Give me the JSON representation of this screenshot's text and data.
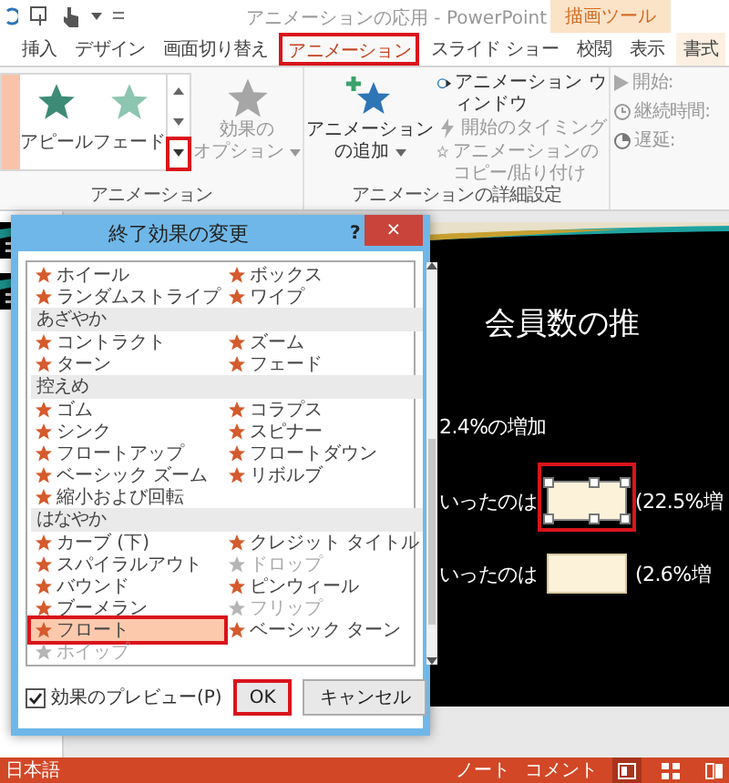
{
  "title_bar": {
    "title": "アニメーションの応用 - PowerPoint",
    "context_group": "描画ツール"
  },
  "tabs": [
    {
      "label": "挿入",
      "selected": false,
      "annotated": false,
      "kind": "normal"
    },
    {
      "label": "デザイン",
      "selected": false,
      "annotated": false,
      "kind": "normal"
    },
    {
      "label": "画面切り替え",
      "selected": false,
      "annotated": false,
      "kind": "normal"
    },
    {
      "label": "アニメーション",
      "selected": true,
      "annotated": true,
      "kind": "normal"
    },
    {
      "label": "スライド ショー",
      "selected": false,
      "annotated": false,
      "kind": "normal"
    },
    {
      "label": "校閲",
      "selected": false,
      "annotated": false,
      "kind": "normal"
    },
    {
      "label": "表示",
      "selected": false,
      "annotated": false,
      "kind": "normal"
    },
    {
      "label": "書式",
      "selected": false,
      "annotated": false,
      "kind": "contextual"
    }
  ],
  "ribbon": {
    "gallery": {
      "items": [
        {
          "selected": true
        },
        {
          "label": "アピール",
          "selected": false,
          "color": "#3d8b76"
        },
        {
          "label": "フェード",
          "selected": false,
          "color": "#8cc5b0"
        }
      ],
      "more_annotated": true
    },
    "effect_options": {
      "lines": [
        "効果の",
        "オプション"
      ],
      "disabled": true
    },
    "add_animation": {
      "lines": [
        "アニメーション",
        "の追加"
      ]
    },
    "groups": [
      {
        "label": "アニメーション"
      },
      {
        "label": "アニメーションの詳細設定"
      }
    ],
    "advanced": [
      {
        "label": "アニメーション ウィンドウ",
        "disabled": false,
        "kind": "pane"
      },
      {
        "label": "開始のタイミング",
        "disabled": true,
        "kind": "trigger"
      },
      {
        "label": "アニメーションのコピー/貼り付け",
        "disabled": true,
        "kind": "painter"
      }
    ],
    "timing": [
      {
        "label": "開始:",
        "kind": "start",
        "disabled": true
      },
      {
        "label": "継続時間:",
        "kind": "duration",
        "disabled": true
      },
      {
        "label": "遅延:",
        "kind": "delay",
        "disabled": true
      }
    ]
  },
  "slide": {
    "title": "会員数の推",
    "lines": [
      {
        "kind": "text",
        "text": "2.4%の増加"
      },
      {
        "kind": "blank",
        "before": "いったのは",
        "after": "(22.5%増",
        "selected": true,
        "annotated": true
      },
      {
        "kind": "blank",
        "before": "いったのは",
        "after": "(2.6%増",
        "selected": false,
        "annotated": false
      }
    ]
  },
  "dialog": {
    "title": "終了効果の変更",
    "help": "?",
    "close": "×",
    "entries": [
      {
        "kind": "effect",
        "label": "ホイール",
        "disabled": false,
        "selected": false,
        "annotated": false
      },
      {
        "kind": "effect",
        "label": "ボックス",
        "disabled": false,
        "selected": false,
        "annotated": false
      },
      {
        "kind": "effect",
        "label": "ランダムストライプ",
        "disabled": false,
        "selected": false,
        "annotated": false
      },
      {
        "kind": "effect",
        "label": "ワイプ",
        "disabled": false,
        "selected": false,
        "annotated": false
      },
      {
        "kind": "heading",
        "label": "あざやか"
      },
      {
        "kind": "effect",
        "label": "コントラクト",
        "disabled": false,
        "selected": false,
        "annotated": false
      },
      {
        "kind": "effect",
        "label": "ズーム",
        "disabled": false,
        "selected": false,
        "annotated": false
      },
      {
        "kind": "effect",
        "label": "ターン",
        "disabled": false,
        "selected": false,
        "annotated": false
      },
      {
        "kind": "effect",
        "label": "フェード",
        "disabled": false,
        "selected": false,
        "annotated": false
      },
      {
        "kind": "heading",
        "label": "控えめ"
      },
      {
        "kind": "effect",
        "label": "ゴム",
        "disabled": false,
        "selected": false,
        "annotated": false
      },
      {
        "kind": "effect",
        "label": "コラプス",
        "disabled": false,
        "selected": false,
        "annotated": false
      },
      {
        "kind": "effect",
        "label": "シンク",
        "disabled": false,
        "selected": false,
        "annotated": false
      },
      {
        "kind": "effect",
        "label": "スピナー",
        "disabled": false,
        "selected": false,
        "annotated": false
      },
      {
        "kind": "effect",
        "label": "フロートアップ",
        "disabled": false,
        "selected": false,
        "annotated": false
      },
      {
        "kind": "effect",
        "label": "フロートダウン",
        "disabled": false,
        "selected": false,
        "annotated": false
      },
      {
        "kind": "effect",
        "label": "ベーシック ズーム",
        "disabled": false,
        "selected": false,
        "annotated": false
      },
      {
        "kind": "effect",
        "label": "リボルブ",
        "disabled": false,
        "selected": false,
        "annotated": false
      },
      {
        "kind": "effect",
        "label": "縮小および回転",
        "disabled": false,
        "selected": false,
        "annotated": false
      },
      {
        "kind": "heading",
        "label": "はなやか"
      },
      {
        "kind": "effect",
        "label": "カーブ (下)",
        "disabled": false,
        "selected": false,
        "annotated": false
      },
      {
        "kind": "effect",
        "label": "クレジット タイトル",
        "disabled": false,
        "selected": false,
        "annotated": false
      },
      {
        "kind": "effect",
        "label": "スパイラルアウト",
        "disabled": false,
        "selected": false,
        "annotated": false
      },
      {
        "kind": "effect",
        "label": "ドロップ",
        "disabled": true,
        "selected": false,
        "annotated": false
      },
      {
        "kind": "effect",
        "label": "バウンド",
        "disabled": false,
        "selected": false,
        "annotated": false
      },
      {
        "kind": "effect",
        "label": "ピンウィール",
        "disabled": false,
        "selected": false,
        "annotated": false
      },
      {
        "kind": "effect",
        "label": "ブーメラン",
        "disabled": false,
        "selected": false,
        "annotated": false
      },
      {
        "kind": "effect",
        "label": "フリップ",
        "disabled": true,
        "selected": false,
        "annotated": false
      },
      {
        "kind": "effect",
        "label": "フロート",
        "disabled": false,
        "selected": true,
        "annotated": true
      },
      {
        "kind": "effect",
        "label": "ベーシック ターン",
        "disabled": false,
        "selected": false,
        "annotated": false
      },
      {
        "kind": "effect",
        "label": "ホイップ",
        "disabled": true,
        "selected": false,
        "annotated": false
      }
    ],
    "preview": {
      "label": "効果のプレビュー(P)",
      "checked": true
    },
    "buttons": [
      {
        "label": "OK",
        "kind": "default",
        "annotated": true
      },
      {
        "label": "キャンセル",
        "kind": "cancel",
        "annotated": false
      }
    ]
  },
  "status_bar": {
    "language": "日本語",
    "notes": "ノート",
    "comments": "コメント",
    "views": [
      {
        "kind": "normal",
        "selected": true
      },
      {
        "kind": "sorter",
        "selected": false
      },
      {
        "kind": "reading",
        "selected": false
      }
    ]
  }
}
